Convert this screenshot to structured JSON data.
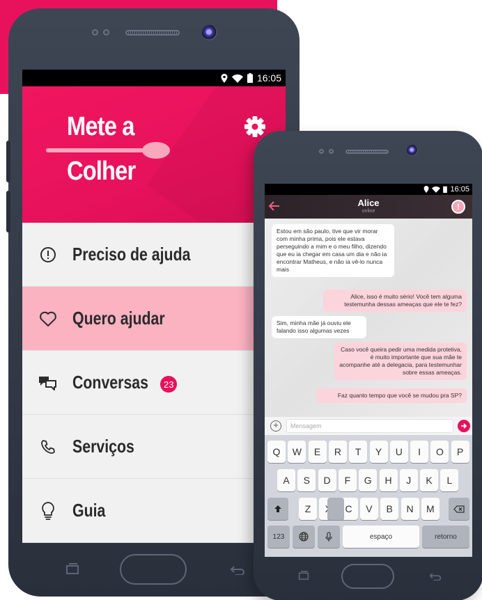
{
  "app": {
    "logo_line1": "Mete a",
    "logo_line2": "Colher",
    "brand_color": "#e8125c",
    "status_time": "16:05"
  },
  "menu": {
    "items": [
      {
        "label": "Preciso de ajuda",
        "icon": "exclamation-circle-icon"
      },
      {
        "label": "Quero ajudar",
        "icon": "heart-icon",
        "active": true
      },
      {
        "label": "Conversas",
        "icon": "chat-bubbles-icon",
        "badge": "23"
      },
      {
        "label": "Serviços",
        "icon": "phone-icon"
      },
      {
        "label": "Guia",
        "icon": "lightbulb-icon"
      }
    ]
  },
  "chat": {
    "contact_name": "Alice",
    "contact_status": "online",
    "messages": [
      {
        "direction": "in",
        "text": "Estou em são paulo, tive que vir morar com minha prima, pois ele estava perseguindo a mim e o meu filho, dizendo que eu ia chegar em casa um dia e não ia encontrar Matheus, e não ia vê-lo nunca mais"
      },
      {
        "direction": "out",
        "text": "Alice, isso é muito sério! Você tem alguma testemunha dessas ameaças que ele te fez?"
      },
      {
        "direction": "in",
        "text": "Sim, minha mãe já ouviu ele falando isso algumas vezes"
      },
      {
        "direction": "out",
        "text": "Caso você queira pedir uma medida protetiva, é muito importante que sua mãe te acompanhe até a delegacia, para testemunhar sobre essas ameaças."
      },
      {
        "direction": "out",
        "text": "Faz quanto tempo que você se mudou pra SP?"
      }
    ],
    "input_placeholder": "Mensagem"
  },
  "keyboard": {
    "row1": [
      "Q",
      "W",
      "E",
      "R",
      "T",
      "Y",
      "U",
      "I",
      "O",
      "P"
    ],
    "row2": [
      "A",
      "S",
      "D",
      "F",
      "G",
      "H",
      "J",
      "K",
      "L"
    ],
    "row3": [
      "Z",
      "X",
      "C",
      "V",
      "B",
      "N",
      "M"
    ],
    "numbers_key": "123",
    "space_key": "espaço",
    "return_key": "retorno"
  }
}
